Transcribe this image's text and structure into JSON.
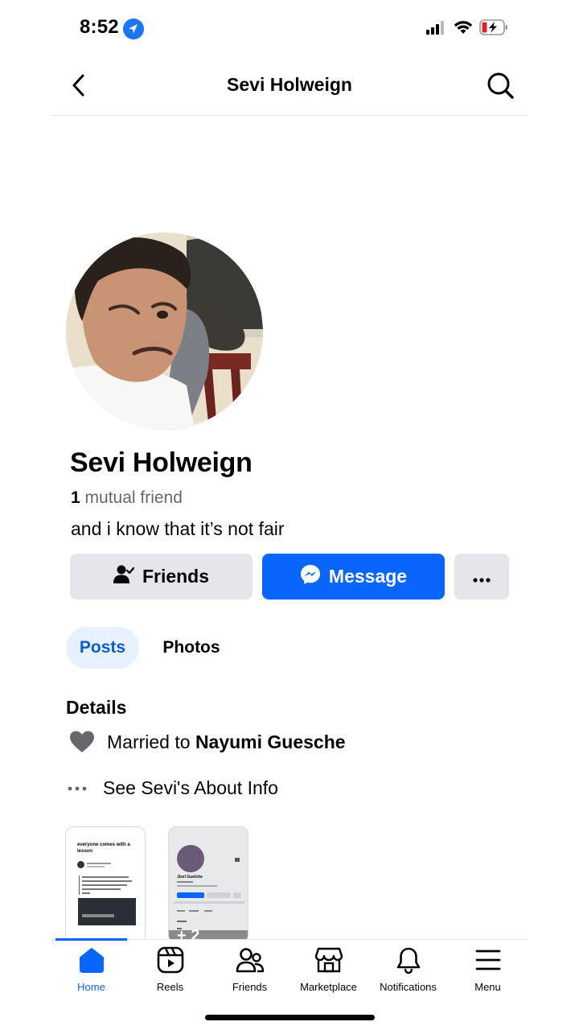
{
  "status_bar": {
    "time": "8:52"
  },
  "header": {
    "title": "Sevi Holweign"
  },
  "profile": {
    "name": "Sevi Holweign",
    "mutual_count": "1",
    "mutual_text": " mutual friend",
    "bio": "and i know that it’s not fair"
  },
  "actions": {
    "friends_label": "Friends",
    "message_label": "Message"
  },
  "tabs": {
    "posts": "Posts",
    "photos": "Photos"
  },
  "details": {
    "title": "Details",
    "married_prefix": "Married to ",
    "married_name": "Nayumi Guesche",
    "about_label": "See Sevi's About Info"
  },
  "stories": {
    "first_caption": "everyone comes with a lesson",
    "second_name": "Jizel Guelche",
    "second_count": "+ 2"
  },
  "nav": {
    "home": "Home",
    "reels": "Reels",
    "friends": "Friends",
    "marketplace": "Marketplace",
    "notifications": "Notifications",
    "menu": "Menu"
  },
  "colors": {
    "accent": "#0866ff",
    "tab_bg": "#e7f0fd",
    "button_gray": "#e4e6eb",
    "battery_low": "#e0242b"
  },
  "icons": [
    "location-arrow-icon",
    "signal-icon",
    "wifi-icon",
    "battery-icon",
    "back-chevron-icon",
    "search-icon",
    "friends-check-icon",
    "messenger-icon",
    "more-dots-icon",
    "heart-icon",
    "home-icon",
    "reels-icon",
    "friends-icon",
    "marketplace-icon",
    "bell-icon",
    "menu-icon"
  ]
}
